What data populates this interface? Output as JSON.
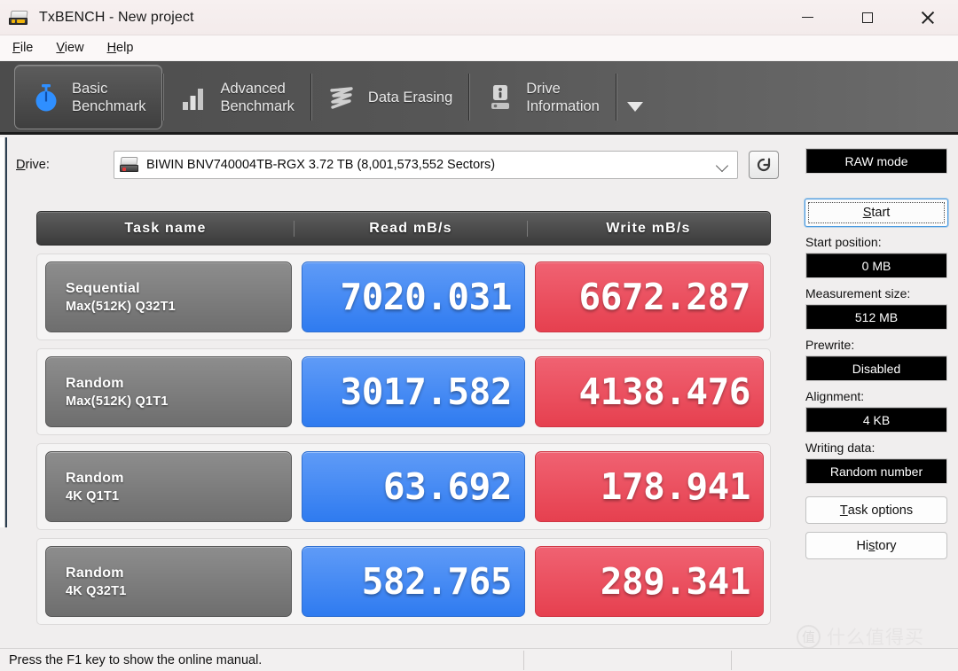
{
  "window": {
    "title": "TxBENCH - New project",
    "app_icon": "drive-icon",
    "controls": {
      "minimize": "minimize-icon",
      "maximize": "maximize-icon",
      "close": "close-icon"
    }
  },
  "menubar": {
    "items": [
      {
        "mnemonic": "F",
        "rest": "ile"
      },
      {
        "mnemonic": "V",
        "rest": "iew"
      },
      {
        "mnemonic": "H",
        "rest": "elp"
      }
    ]
  },
  "tabs": [
    {
      "label": "Basic\nBenchmark",
      "icon": "stopwatch-icon",
      "active": true
    },
    {
      "label": "Advanced\nBenchmark",
      "icon": "bar-chart-icon",
      "active": false
    },
    {
      "label": "Data Erasing",
      "icon": "erase-wave-icon",
      "active": false
    },
    {
      "label": "Drive\nInformation",
      "icon": "drive-info-icon",
      "active": false
    }
  ],
  "tab_overflow_icon": "chevron-down-icon",
  "drive": {
    "label": "Drive:",
    "label_mnemonic": "D",
    "label_rest": "rive:",
    "value": "BIWIN BNV740004TB-RGX  3.72 TB (8,001,573,552 Sectors)",
    "device_icon": "hard-drive-icon",
    "caret_icon": "chevron-down-icon",
    "refresh_icon": "refresh-icon"
  },
  "table": {
    "headers": {
      "task": "Task name",
      "read": "Read mB/s",
      "write": "Write mB/s"
    },
    "rows": [
      {
        "task_line1": "Sequential",
        "task_line2": "Max(512K) Q32T1",
        "read": "7020.031",
        "write": "6672.287"
      },
      {
        "task_line1": "Random",
        "task_line2": "Max(512K) Q1T1",
        "read": "3017.582",
        "write": "4138.476"
      },
      {
        "task_line1": "Random",
        "task_line2": "4K Q1T1",
        "read": "63.692",
        "write": "178.941"
      },
      {
        "task_line1": "Random",
        "task_line2": "4K Q32T1",
        "read": "582.765",
        "write": "289.341"
      }
    ]
  },
  "panel": {
    "raw_mode": "RAW mode",
    "start_mnemonic": "S",
    "start_rest": "tart",
    "start_position_label": "Start position:",
    "start_position_value": "0 MB",
    "measurement_size_label": "Measurement size:",
    "measurement_size_value": "512 MB",
    "prewrite_label": "Prewrite:",
    "prewrite_value": "Disabled",
    "alignment_label": "Alignment:",
    "alignment_value": "4 KB",
    "writing_data_label": "Writing data:",
    "writing_data_value": "Random number",
    "task_options_mnemonic": "T",
    "task_options_rest": "ask options",
    "history_prefix": "Hi",
    "history_mnemonic": "s",
    "history_rest": "tory"
  },
  "statusbar": {
    "text": "Press the F1 key to show the online manual."
  },
  "watermark": {
    "mark": "值",
    "text": "什么值得买"
  },
  "colors": {
    "read_blue": "#2F7BF0",
    "write_red": "#E6404F",
    "tab_strip": "#565656",
    "task_gray": "#7E7E7E",
    "accent_focus": "#4A9AE0"
  }
}
